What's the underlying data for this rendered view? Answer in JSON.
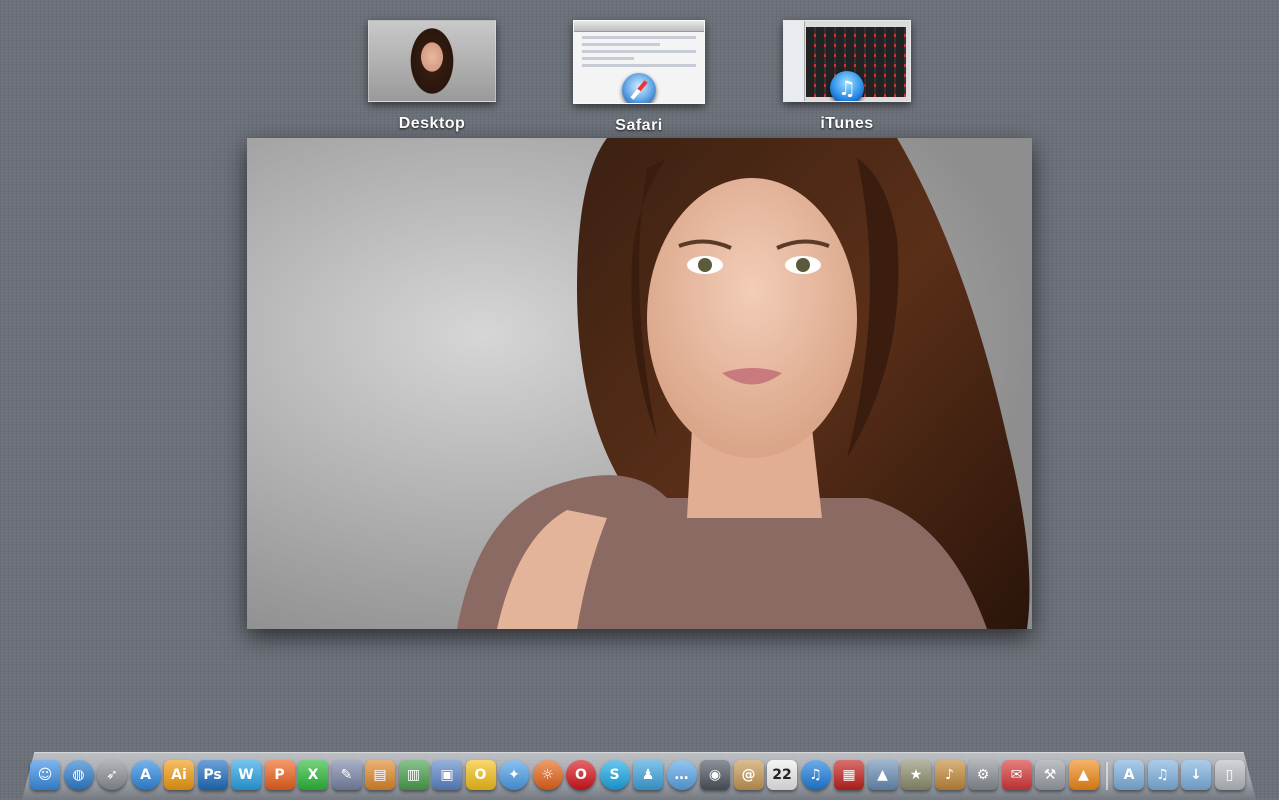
{
  "spaces": [
    {
      "label": "Desktop"
    },
    {
      "label": "Safari"
    },
    {
      "label": "iTunes"
    }
  ],
  "dock": {
    "apps": [
      {
        "name": "finder-icon",
        "glyph": "☺",
        "color": "#3a8ee6",
        "round": false
      },
      {
        "name": "globe-icon",
        "glyph": "◍",
        "color": "#2f7fd0",
        "round": true
      },
      {
        "name": "launchpad-icon",
        "glyph": "➶",
        "color": "#8d8f95",
        "round": true
      },
      {
        "name": "app-store-icon",
        "glyph": "A",
        "color": "#2e8be3",
        "round": true
      },
      {
        "name": "illustrator-icon",
        "glyph": "Ai",
        "color": "#f29c12",
        "round": false
      },
      {
        "name": "photoshop-icon",
        "glyph": "Ps",
        "color": "#1f6fc2",
        "round": false
      },
      {
        "name": "pages-icon",
        "glyph": "W",
        "color": "#2aa4e8",
        "round": false
      },
      {
        "name": "keynote-p-icon",
        "glyph": "P",
        "color": "#f0621c",
        "round": false
      },
      {
        "name": "numbers-x-icon",
        "glyph": "X",
        "color": "#2dbb3a",
        "round": false
      },
      {
        "name": "pen-tool-icon",
        "glyph": "✎",
        "color": "#7b86a8",
        "round": false
      },
      {
        "name": "keynote-icon",
        "glyph": "▤",
        "color": "#e0892c",
        "round": false
      },
      {
        "name": "numbers-icon",
        "glyph": "▥",
        "color": "#4aa34f",
        "round": false
      },
      {
        "name": "preview-icon",
        "glyph": "▣",
        "color": "#5c87c8",
        "round": false
      },
      {
        "name": "opera-o-icon",
        "glyph": "O",
        "color": "#f6c21a",
        "round": false
      },
      {
        "name": "safari-icon",
        "glyph": "✦",
        "color": "#4da0ea",
        "round": true
      },
      {
        "name": "firefox-icon",
        "glyph": "☼",
        "color": "#e8661b",
        "round": true
      },
      {
        "name": "opera-icon",
        "glyph": "O",
        "color": "#d8141c",
        "round": true
      },
      {
        "name": "skype-icon",
        "glyph": "S",
        "color": "#1aa9e6",
        "round": true
      },
      {
        "name": "messenger-icon",
        "glyph": "♟",
        "color": "#3fa4e0",
        "round": false
      },
      {
        "name": "ichat-icon",
        "glyph": "…",
        "color": "#5aa7ea",
        "round": true
      },
      {
        "name": "facetime-icon",
        "glyph": "◉",
        "color": "#4e5460",
        "round": false
      },
      {
        "name": "address-book-icon",
        "glyph": "@",
        "color": "#c79a55",
        "round": false
      },
      {
        "name": "calendar-icon",
        "glyph": "22",
        "color": "#f0f0f0",
        "round": false
      },
      {
        "name": "itunes-icon",
        "glyph": "♫",
        "color": "#1d7fe0",
        "round": true
      },
      {
        "name": "photo-booth-icon",
        "glyph": "▦",
        "color": "#c4211d",
        "round": false
      },
      {
        "name": "iphoto-icon",
        "glyph": "▲",
        "color": "#6a8fb8",
        "round": false
      },
      {
        "name": "imovie-icon",
        "glyph": "★",
        "color": "#8f8f70",
        "round": false
      },
      {
        "name": "garageband-icon",
        "glyph": "♪",
        "color": "#c48a3a",
        "round": false
      },
      {
        "name": "system-preferences-icon",
        "glyph": "⚙",
        "color": "#8a8f97",
        "round": false
      },
      {
        "name": "mail-stamp-icon",
        "glyph": "✉",
        "color": "#d8383a",
        "round": false
      },
      {
        "name": "automator-icon",
        "glyph": "⚒",
        "color": "#9aa0a8",
        "round": false
      },
      {
        "name": "vlc-icon",
        "glyph": "▲",
        "color": "#f28a18",
        "round": false
      }
    ],
    "folders": [
      {
        "name": "applications-folder-icon",
        "glyph": "A",
        "color": "#7fb2e0"
      },
      {
        "name": "music-folder-icon",
        "glyph": "♫",
        "color": "#7fb2e0"
      },
      {
        "name": "downloads-folder-icon",
        "glyph": "↓",
        "color": "#7fb2e0"
      },
      {
        "name": "trash-icon",
        "glyph": "▯",
        "color": "#b9bdc3"
      }
    ]
  }
}
